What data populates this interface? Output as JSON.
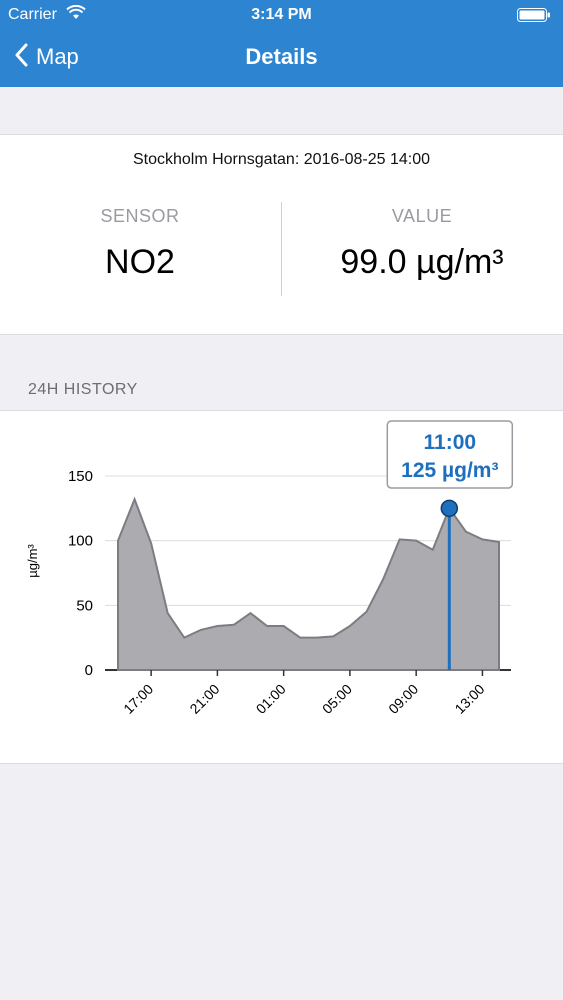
{
  "status_bar": {
    "carrier": "Carrier",
    "time": "3:14 PM"
  },
  "nav": {
    "back_label": "Map",
    "title": "Details"
  },
  "info": {
    "station": "Stockholm Hornsgatan: 2016-08-25 14:00",
    "sensor_label": "SENSOR",
    "sensor_value": "NO2",
    "value_label": "VALUE",
    "value_value": "99.0 µg/m³"
  },
  "history": {
    "section_title": "24H HISTORY"
  },
  "chart_data": {
    "type": "area",
    "ylabel": "µg/m³",
    "ylim": [
      0,
      150
    ],
    "yticks": [
      0,
      50,
      100,
      150
    ],
    "x": [
      "15:00",
      "16:00",
      "17:00",
      "18:00",
      "19:00",
      "20:00",
      "21:00",
      "22:00",
      "23:00",
      "00:00",
      "01:00",
      "02:00",
      "03:00",
      "04:00",
      "05:00",
      "06:00",
      "07:00",
      "08:00",
      "09:00",
      "10:00",
      "11:00",
      "12:00",
      "13:00",
      "14:00"
    ],
    "values": [
      100,
      132,
      98,
      44,
      25,
      31,
      34,
      35,
      44,
      34,
      34,
      25,
      25,
      26,
      34,
      45,
      70,
      101,
      100,
      93,
      125,
      107,
      101,
      99
    ],
    "xtick_labels": [
      "17:00",
      "21:00",
      "01:00",
      "05:00",
      "09:00",
      "13:00"
    ],
    "highlight": {
      "time": "11:00",
      "value": 125,
      "label": "125 µg/m³"
    },
    "grid": true,
    "colors": {
      "area": "#acabb0",
      "line": "#7d7c82",
      "marker": "#1f6fbf",
      "callout_text": "#1f6fbf"
    }
  }
}
